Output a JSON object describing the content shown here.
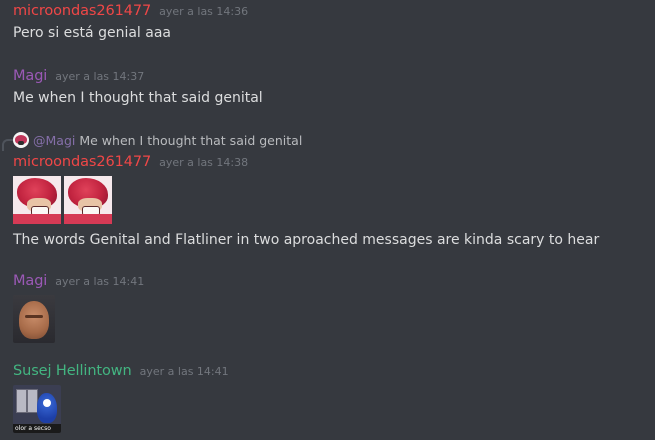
{
  "messages": [
    {
      "author": "microondas261477",
      "author_color": "#f04747",
      "timestamp": "ayer a las 14:36",
      "content": "Pero si está genial aaa"
    },
    {
      "author": "Magi",
      "author_color": "#9b59b6",
      "timestamp": "ayer a las 14:37",
      "content": "Me when I thought that said genital"
    },
    {
      "reply": {
        "mention": "@Magi",
        "text": "Me when I thought that said genital"
      },
      "author": "microondas261477",
      "author_color": "#f04747",
      "timestamp": "ayer a las 14:38",
      "emojis": [
        "knuckles-emoji",
        "knuckles-emoji"
      ],
      "content": "The words Genital and Flatliner in two aproached messages are kinda scary to hear"
    },
    {
      "author": "Magi",
      "author_color": "#9b59b6",
      "timestamp": "ayer a las 14:41",
      "image": "rock-face-image"
    },
    {
      "author": "Susej Hellintown",
      "author_color": "#43b581",
      "timestamp": "ayer a las 14:41",
      "image": "sonic-image",
      "image_caption": "olor a secso"
    }
  ]
}
